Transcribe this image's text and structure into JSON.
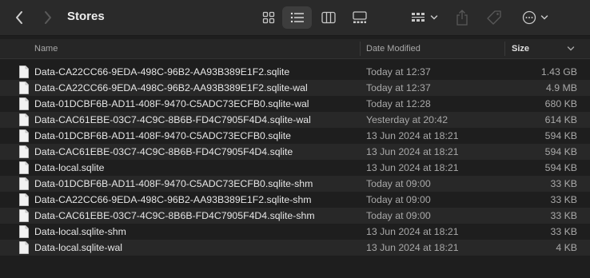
{
  "window": {
    "title": "Stores"
  },
  "toolbar": {
    "icons": [
      "chevron-left-icon",
      "chevron-right-icon",
      "icon-grid-icon",
      "list-icon",
      "columns-icon",
      "gallery-icon",
      "group-icon",
      "share-icon",
      "tag-icon",
      "more-icon"
    ]
  },
  "columns": {
    "name": "Name",
    "date": "Date Modified",
    "size": "Size"
  },
  "files": [
    {
      "name": "Data-CA22CC66-9EDA-498C-96B2-AA93B389E1F2.sqlite",
      "date": "Today at 12:37",
      "size": "1.43 GB"
    },
    {
      "name": "Data-CA22CC66-9EDA-498C-96B2-AA93B389E1F2.sqlite-wal",
      "date": "Today at 12:37",
      "size": "4.9 MB"
    },
    {
      "name": "Data-01DCBF6B-AD11-408F-9470-C5ADC73ECFB0.sqlite-wal",
      "date": "Today at 12:28",
      "size": "680 KB"
    },
    {
      "name": "Data-CAC61EBE-03C7-4C9C-8B6B-FD4C7905F4D4.sqlite-wal",
      "date": "Yesterday at 20:42",
      "size": "614 KB"
    },
    {
      "name": "Data-01DCBF6B-AD11-408F-9470-C5ADC73ECFB0.sqlite",
      "date": "13 Jun 2024 at 18:21",
      "size": "594 KB"
    },
    {
      "name": "Data-CAC61EBE-03C7-4C9C-8B6B-FD4C7905F4D4.sqlite",
      "date": "13 Jun 2024 at 18:21",
      "size": "594 KB"
    },
    {
      "name": "Data-local.sqlite",
      "date": "13 Jun 2024 at 18:21",
      "size": "594 KB"
    },
    {
      "name": "Data-01DCBF6B-AD11-408F-9470-C5ADC73ECFB0.sqlite-shm",
      "date": "Today at 09:00",
      "size": "33 KB"
    },
    {
      "name": "Data-CA22CC66-9EDA-498C-96B2-AA93B389E1F2.sqlite-shm",
      "date": "Today at 09:00",
      "size": "33 KB"
    },
    {
      "name": "Data-CAC61EBE-03C7-4C9C-8B6B-FD4C7905F4D4.sqlite-shm",
      "date": "Today at 09:00",
      "size": "33 KB"
    },
    {
      "name": "Data-local.sqlite-shm",
      "date": "13 Jun 2024 at 18:21",
      "size": "33 KB"
    },
    {
      "name": "Data-local.sqlite-wal",
      "date": "13 Jun 2024 at 18:21",
      "size": "4 KB"
    }
  ]
}
